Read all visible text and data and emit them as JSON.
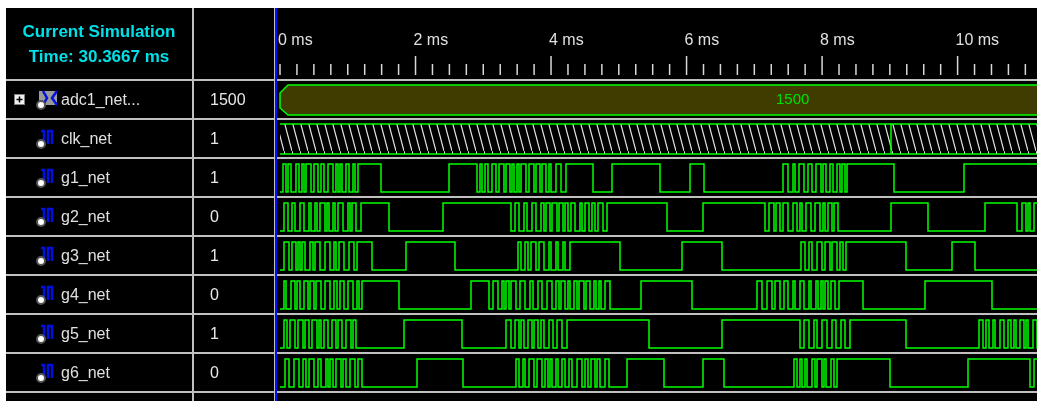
{
  "header": {
    "title_line1": "Current Simulation",
    "title_line2": "Time: 30.3667 ms"
  },
  "ruler": {
    "labels": [
      "0 ms",
      "2 ms",
      "4 ms",
      "6 ms",
      "8 ms",
      "10 ms"
    ]
  },
  "signals": [
    {
      "kind": "bus",
      "name": "adc1_net...",
      "value": "1500",
      "expanded": false,
      "wave_value": "1500"
    },
    {
      "kind": "clock",
      "name": "clk_net",
      "value": "1"
    },
    {
      "kind": "bit",
      "name": "g1_net",
      "value": "1"
    },
    {
      "kind": "bit",
      "name": "g2_net",
      "value": "0"
    },
    {
      "kind": "bit",
      "name": "g3_net",
      "value": "1"
    },
    {
      "kind": "bit",
      "name": "g4_net",
      "value": "0"
    },
    {
      "kind": "bit",
      "name": "g5_net",
      "value": "1"
    },
    {
      "kind": "bit",
      "name": "g6_net",
      "value": "0"
    }
  ]
}
